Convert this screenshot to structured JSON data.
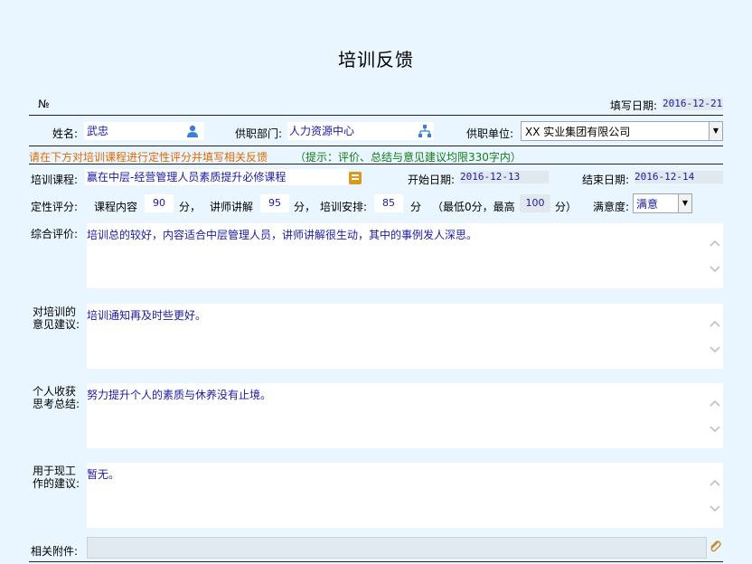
{
  "title": "培训反馈",
  "header": {
    "no_label": "№",
    "fill_date_label": "填写日期:",
    "fill_date": "2016-12-21"
  },
  "person": {
    "name_label": "姓名:",
    "name": "武忠",
    "dept_label": "供职部门:",
    "dept": "人力资源中心",
    "unit_label": "供职单位:",
    "unit": "XX 实业集团有限公司"
  },
  "notice": {
    "main": "请在下方对培训课程进行定性评分并填写相关反馈",
    "hint": "（提示：评价、总结与意见建议均限330字内）"
  },
  "course": {
    "label": "培训课程:",
    "name": "赢在中层-经营管理人员素质提升必修课程",
    "start_label": "开始日期:",
    "start": "2016-12-13",
    "end_label": "结束日期:",
    "end": "2016-12-14"
  },
  "scores": {
    "label": "定性评分:",
    "content_label": "课程内容",
    "content": "90",
    "unit1": "分，",
    "teacher_label": "讲师讲解",
    "teacher": "95",
    "unit2": "分，",
    "arrange_label": "培训安排:",
    "arrange": "85",
    "unit3": "分",
    "range_prefix": "（最低0分，最高",
    "max": "100",
    "range_suffix": "分）",
    "satisfaction_label": "满意度:",
    "satisfaction": "满意"
  },
  "feedback": {
    "overall_label": "综合评价:",
    "overall": "培训总的较好，内容适合中层管理人员，讲师讲解很生动，其中的事例发人深思。",
    "advice_label_1": "对培训的",
    "advice_label_2": "意见建议:",
    "advice": "培训通知再及时些更好。",
    "summary_label_1": "个人收获",
    "summary_label_2": "思考总结:",
    "summary": "努力提升个人的素质与休养没有止境。",
    "work_label_1": "用于现工",
    "work_label_2": "作的建议:",
    "work": "暂无。",
    "attach_label": "相关附件:"
  }
}
